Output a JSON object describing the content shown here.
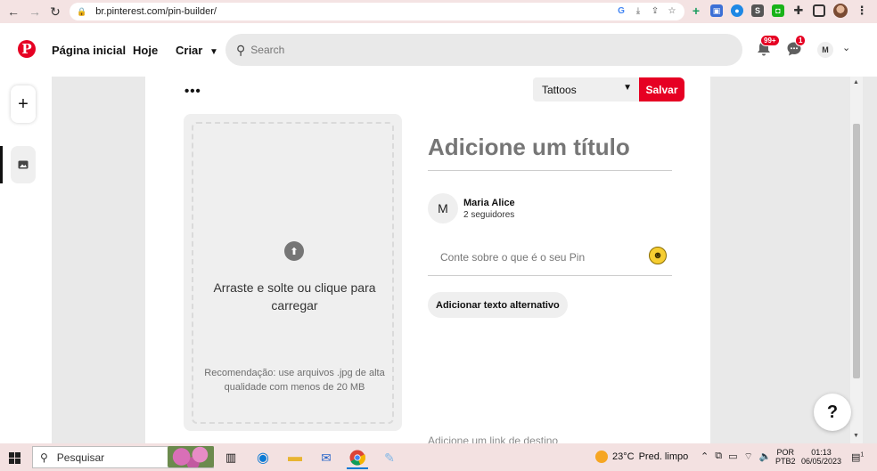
{
  "browser": {
    "url": "br.pinterest.com/pin-builder/"
  },
  "header": {
    "logo": "P",
    "nav": [
      "Página inicial",
      "Hoje",
      "Criar"
    ],
    "search_placeholder": "Search",
    "notifications_badge": "99+",
    "messages_badge": "1",
    "avatar_initial": "M"
  },
  "builder": {
    "board": "Tattoos",
    "save_label": "Salvar",
    "upload_text": "Arraste e solte ou clique para carregar",
    "upload_note": "Recomendação: use arquivos .jpg de alta qualidade com menos de 20 MB",
    "title_placeholder": "Adicione um título",
    "author_initial": "M",
    "author_name": "Maria Alice",
    "author_followers": "2 seguidores",
    "description_placeholder": "Conte sobre o que é o seu Pin",
    "alt_text_button": "Adicionar texto alternativo",
    "destination_link": "Adicione um link de destino"
  },
  "help": "?",
  "taskbar": {
    "search_label": "Pesquisar",
    "weather_temp": "23°C",
    "weather_desc": "Pred. limpo",
    "lang_line1": "POR",
    "lang_line2": "PTB2",
    "time": "01:13",
    "date": "06/05/2023",
    "notification_count": "1"
  },
  "colors": {
    "brand": "#e60023"
  }
}
